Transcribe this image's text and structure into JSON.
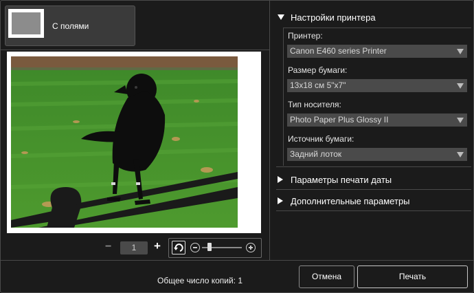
{
  "layout": {
    "selected_label": "С полями"
  },
  "zoom": {
    "value": "1",
    "minus": "−",
    "plus": "+"
  },
  "printer_settings": {
    "title": "Настройки принтера",
    "fields": [
      {
        "label": "Принтер:",
        "value": "Canon E460 series Printer"
      },
      {
        "label": "Размер бумаги:",
        "value": "13x18 см 5\"x7\""
      },
      {
        "label": "Тип носителя:",
        "value": "Photo Paper Plus Glossy II"
      },
      {
        "label": "Источник бумаги:",
        "value": "Задний лоток"
      }
    ]
  },
  "sections": [
    {
      "title": "Параметры печати даты"
    },
    {
      "title": "Дополнительные параметры"
    }
  ],
  "footer": {
    "copies_label": "Общее число копий: 1",
    "cancel": "Отмена",
    "print": "Печать"
  }
}
